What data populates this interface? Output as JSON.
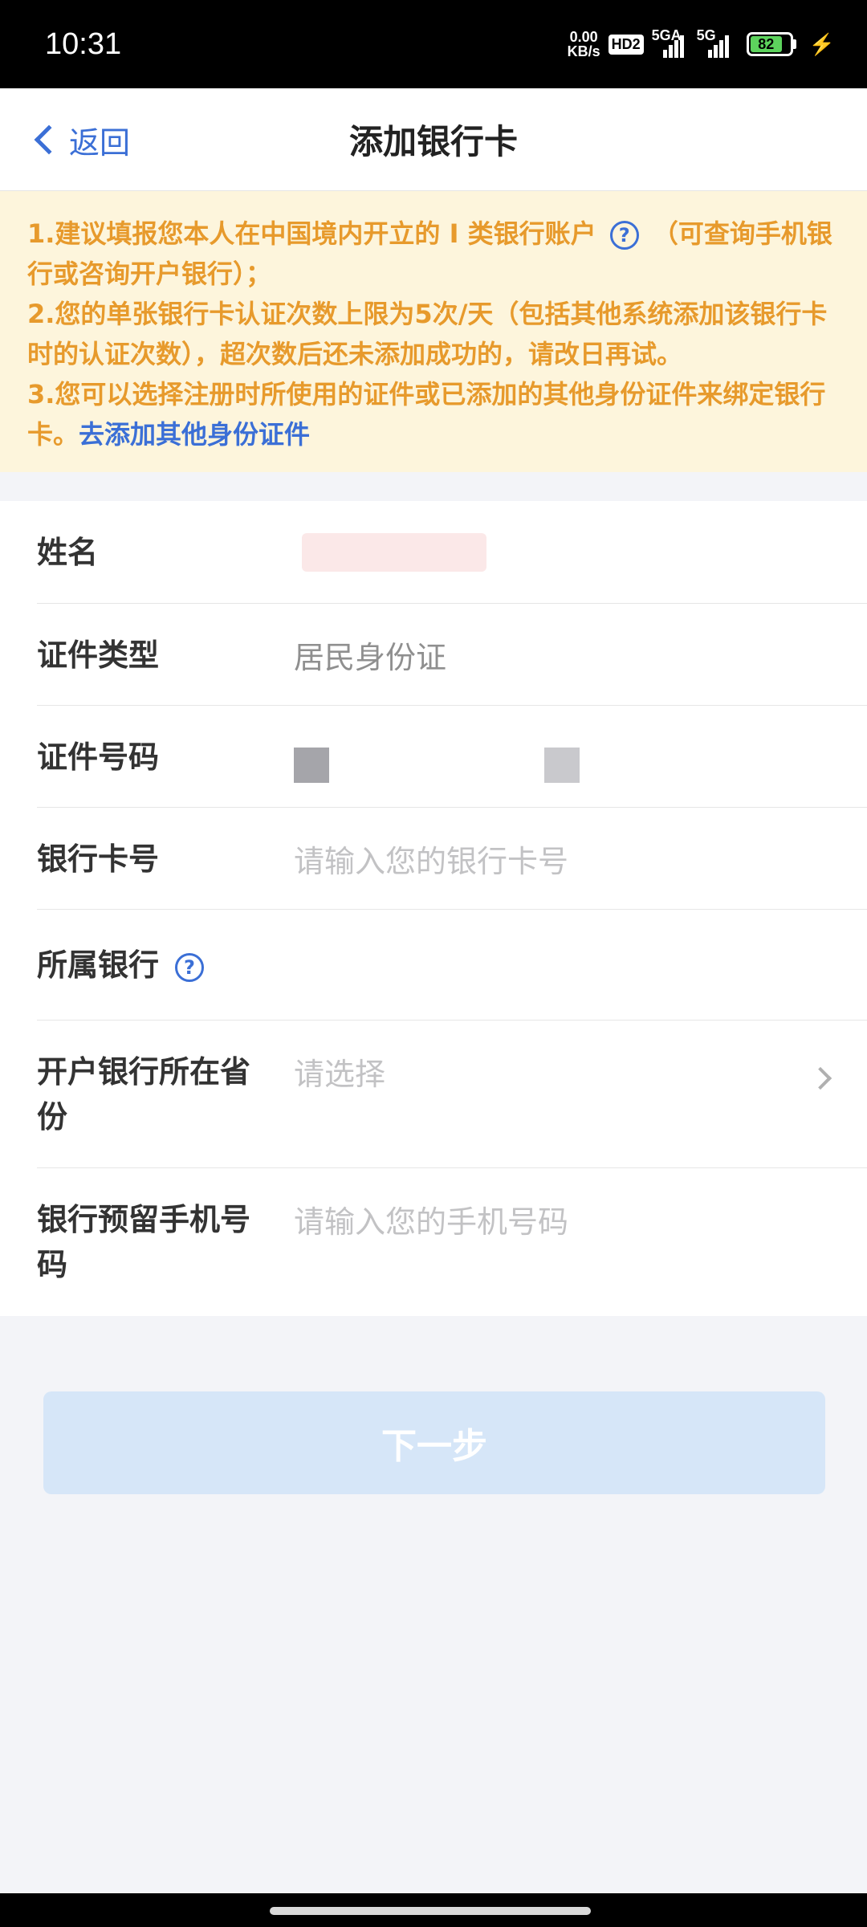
{
  "status_bar": {
    "time": "10:31",
    "net_speed_value": "0.00",
    "net_speed_unit": "KB/s",
    "hd_badge": "HD2",
    "signal1_label": "5GA",
    "signal2_label": "5G",
    "battery": "82"
  },
  "nav": {
    "back_label": "返回",
    "title": "添加银行卡"
  },
  "notice": {
    "line1_a": "1.建议填报您本人在中国境内开立的 I 类银行账户",
    "help_glyph": "?",
    "line1_b": "（可查询手机银行或咨询开户银行）；",
    "line2": "2.您的单张银行卡认证次数上限为5次/天（包括其他系统添加该银行卡时的认证次数），超次数后还未添加成功的，请改日再试。",
    "line3": "3.您可以选择注册时所使用的证件或已添加的其他身份证件来绑定银行卡。",
    "link": "去添加其他身份证件"
  },
  "form": {
    "name_label": "姓名",
    "id_type_label": "证件类型",
    "id_type_value": "居民身份证",
    "id_number_label": "证件号码",
    "card_number_label": "银行卡号",
    "card_number_placeholder": "请输入您的银行卡号",
    "bank_label": "所属银行",
    "bank_help_glyph": "?",
    "province_label": "开户银行所在省份",
    "province_placeholder": "请选择",
    "phone_label": "银行预留手机号码",
    "phone_placeholder": "请输入您的手机号码"
  },
  "next_button": "下一步",
  "colors": {
    "accent": "#3b6fd6",
    "notice_text": "#e79a2c",
    "notice_bg": "#fdf5dc",
    "button_disabled": "#d6e6f8"
  }
}
